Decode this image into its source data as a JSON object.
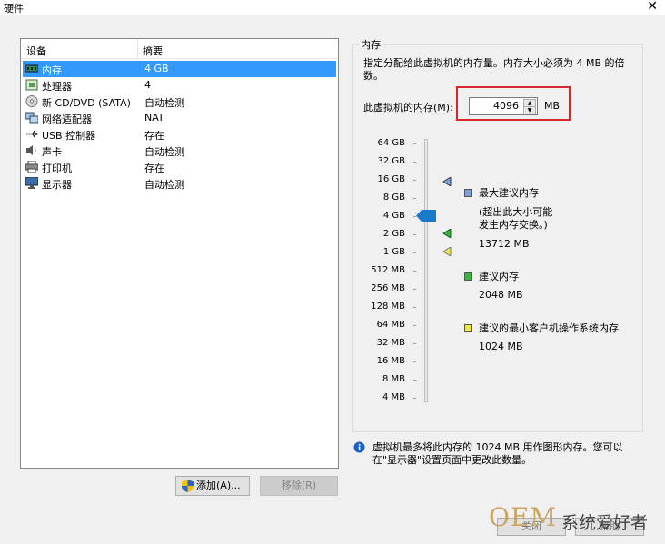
{
  "window": {
    "title": "硬件",
    "close_glyph": "✕"
  },
  "hardware_list": {
    "col_device": "设备",
    "col_summary": "摘要",
    "items": [
      {
        "name": "内存",
        "summary": "4 GB",
        "icon": "memory-icon",
        "selected": true
      },
      {
        "name": "处理器",
        "summary": "4",
        "icon": "processor-icon"
      },
      {
        "name": "新 CD/DVD (SATA)",
        "summary": "自动检测",
        "icon": "cd-dvd-icon"
      },
      {
        "name": "网络适配器",
        "summary": "NAT",
        "icon": "network-adapter-icon"
      },
      {
        "name": "USB 控制器",
        "summary": "存在",
        "icon": "usb-icon"
      },
      {
        "name": "声卡",
        "summary": "自动检测",
        "icon": "sound-card-icon"
      },
      {
        "name": "打印机",
        "summary": "存在",
        "icon": "printer-icon"
      },
      {
        "name": "显示器",
        "summary": "自动检测",
        "icon": "display-icon"
      }
    ]
  },
  "buttons": {
    "add": "添加(A)...",
    "remove": "移除(R)",
    "close": "关闭",
    "help": "帮助"
  },
  "memory": {
    "group_title": "内存",
    "description": "指定分配给此虚拟机的内存量。内存大小必须为 4 MB 的倍数。",
    "field_label": "此虚拟机的内存(M):",
    "value": "4096",
    "unit": "MB",
    "scale_labels": [
      "64 GB",
      "32 GB",
      "16 GB",
      "8 GB",
      "4 GB",
      "2 GB",
      "1 GB",
      "512 MB",
      "256 MB",
      "128 MB",
      "64 MB",
      "32 MB",
      "16 MB",
      "8 MB",
      "4 MB"
    ],
    "legend": {
      "max_title": "最大建议内存",
      "max_note_1": "(超出此大小可能",
      "max_note_2": "发生内存交换。)",
      "max_value": "13712 MB",
      "rec_title": "建议内存",
      "rec_value": "2048 MB",
      "min_title": "建议的最小客户机操作系统内存",
      "min_value": "1024 MB"
    },
    "info": "虚拟机最多将此内存的 1024 MB 用作图形内存。您可以在\"显示器\"设置页面中更改此数量。"
  },
  "colors": {
    "selection": "#3399ff",
    "highlight_box": "#d9262c",
    "max_marker": "#7f9fd0",
    "rec_marker": "#3cb043",
    "min_marker": "#e8e84a",
    "slider_thumb": "#1979ca"
  },
  "watermark": {
    "logo": "OEM",
    "text": "系统爱好者"
  }
}
